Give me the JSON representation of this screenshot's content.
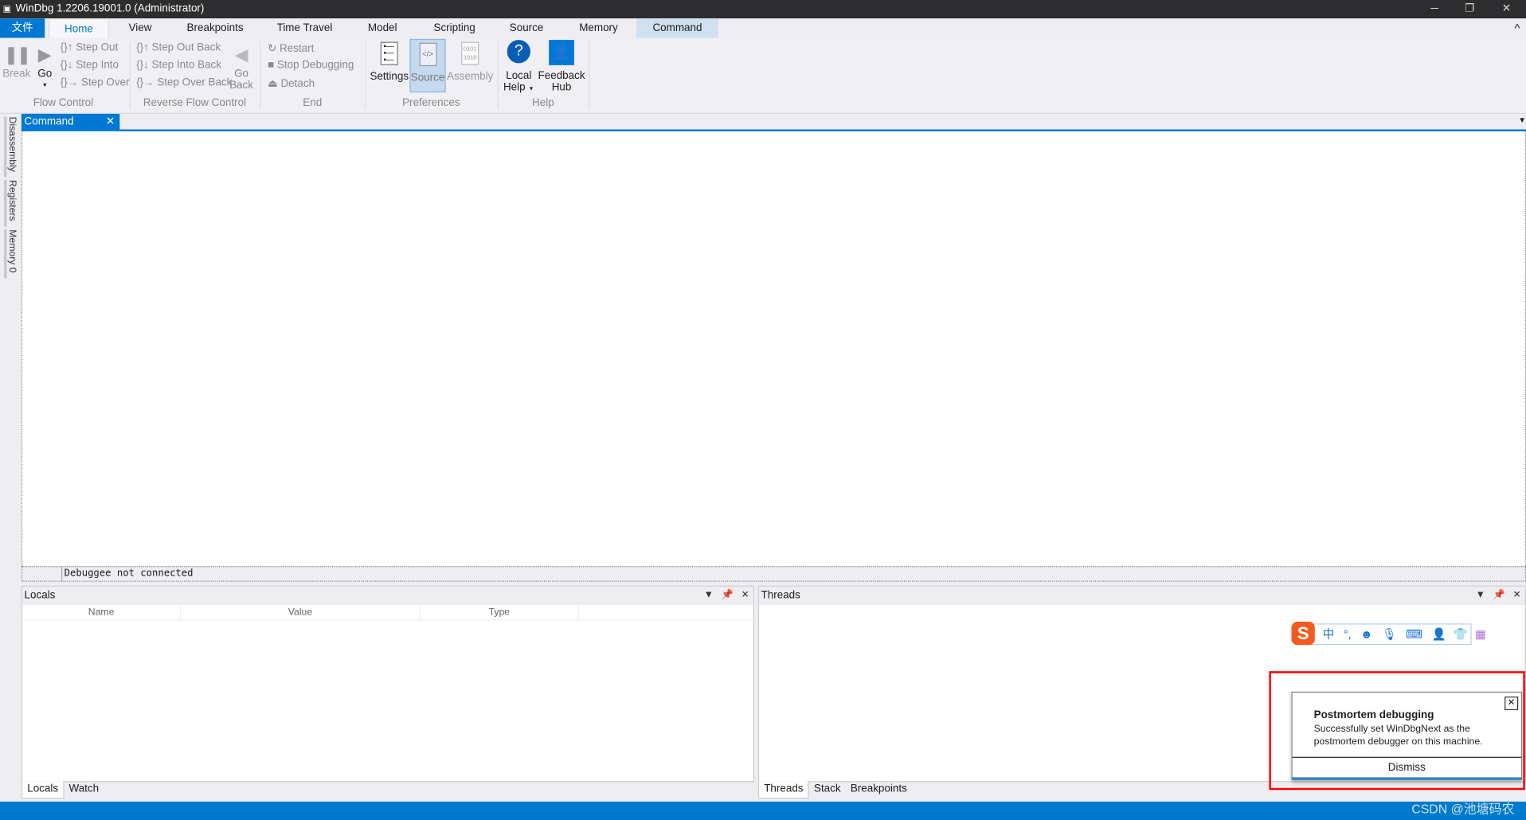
{
  "window": {
    "title": "WinDbg 1.2206.19001.0 (Administrator)",
    "minimize": "─",
    "restore": "❐",
    "close": "✕"
  },
  "ribbon_tabs": {
    "file": "文件",
    "items": [
      "Home",
      "View",
      "Breakpoints",
      "Time Travel",
      "Model",
      "Scripting",
      "Source",
      "Memory",
      "Command"
    ],
    "active": "Home",
    "highlighted": "Command",
    "collapse": "^"
  },
  "ribbon": {
    "flow_control": {
      "label": "Flow Control",
      "break": "Break",
      "go": "Go",
      "step_out": "Step Out",
      "step_into": "Step Into",
      "step_over": "Step Over"
    },
    "reverse_flow": {
      "label": "Reverse Flow Control",
      "step_out_back": "Step Out Back",
      "step_into_back": "Step Into Back",
      "step_over_back": "Step Over Back",
      "go_back_1": "Go",
      "go_back_2": "Back"
    },
    "end": {
      "label": "End",
      "restart": "Restart",
      "stop": "Stop Debugging",
      "detach": "Detach"
    },
    "preferences": {
      "label": "Preferences",
      "settings": "Settings",
      "source": "Source",
      "assembly": "Assembly"
    },
    "help": {
      "label": "Help",
      "local_help_1": "Local",
      "local_help_2": "Help",
      "feedback_1": "Feedback",
      "feedback_2": "Hub"
    }
  },
  "side_tabs": [
    "Disassembly",
    "Registers",
    "Memory 0"
  ],
  "command": {
    "tab": "Command",
    "status": "Debuggee not connected"
  },
  "locals": {
    "title": "Locals",
    "columns": [
      "Name",
      "Value",
      "Type"
    ],
    "tabs": [
      "Locals",
      "Watch"
    ]
  },
  "threads": {
    "title": "Threads",
    "tabs": [
      "Threads",
      "Stack",
      "Breakpoints"
    ]
  },
  "ime": {
    "mode": "中",
    "punct": "°,"
  },
  "toast": {
    "title": "Postmortem debugging",
    "body_1": "Successfully set WinDbgNext as the",
    "body_2": "postmortem debugger on this machine.",
    "dismiss": "Dismiss"
  },
  "watermark": "CSDN @池塘码农",
  "colors": {
    "accent": "#0078d4",
    "statusbar": "#007acc",
    "highlight_box": "#ff0000"
  }
}
